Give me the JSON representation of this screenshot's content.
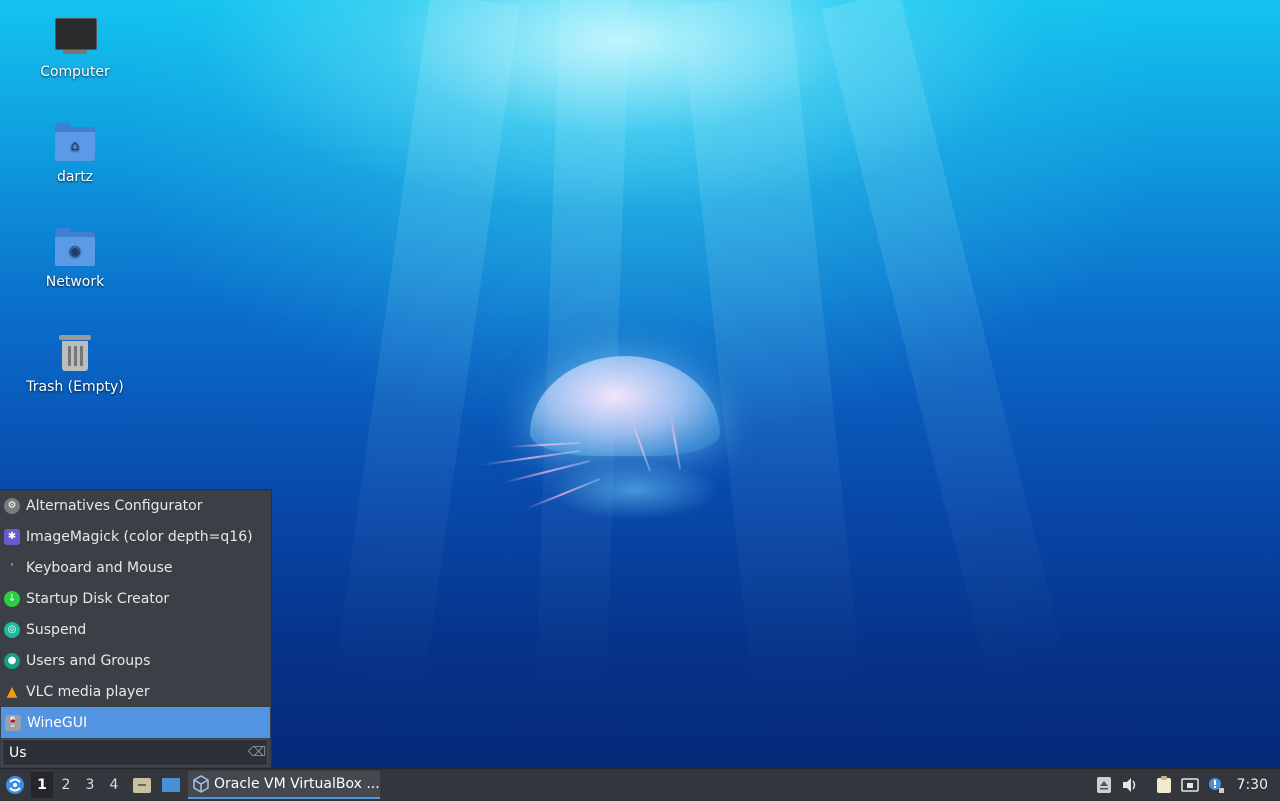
{
  "desktop": {
    "icons": [
      {
        "label": "Computer",
        "icon": "computer-icon"
      },
      {
        "label": "dartz",
        "icon": "home-folder-icon"
      },
      {
        "label": "Network",
        "icon": "network-folder-icon"
      },
      {
        "label": "Trash (Empty)",
        "icon": "trash-icon"
      }
    ]
  },
  "menu": {
    "items": [
      {
        "label": "Alternatives Configurator",
        "icon": "alternatives-icon",
        "color": "#7a7a7a"
      },
      {
        "label": "ImageMagick (color depth=q16)",
        "icon": "imagemagick-icon",
        "color": "#6a5acd"
      },
      {
        "label": "Keyboard and Mouse",
        "icon": "keyboard-mouse-icon",
        "color": "#3b3f46"
      },
      {
        "label": "Startup Disk Creator",
        "icon": "startup-disk-icon",
        "color": "#2ecc40"
      },
      {
        "label": "Suspend",
        "icon": "suspend-icon",
        "color": "#1abc9c"
      },
      {
        "label": "Users and Groups",
        "icon": "users-groups-icon",
        "color": "#16a085"
      },
      {
        "label": "VLC media player",
        "icon": "vlc-icon",
        "color": "#f39c12"
      },
      {
        "label": "WineGUI",
        "icon": "winegui-icon",
        "color": "#9aa0a8",
        "selected": true
      }
    ],
    "search": {
      "value": "Us",
      "clear_icon": "clear-text-icon"
    }
  },
  "taskbar": {
    "workspaces": [
      "1",
      "2",
      "3",
      "4"
    ],
    "active_workspace": "1",
    "task": {
      "label": "Oracle VM VirtualBox ...",
      "icon": "virtualbox-icon"
    },
    "clock": "7:30",
    "accent": "#5294e2"
  }
}
